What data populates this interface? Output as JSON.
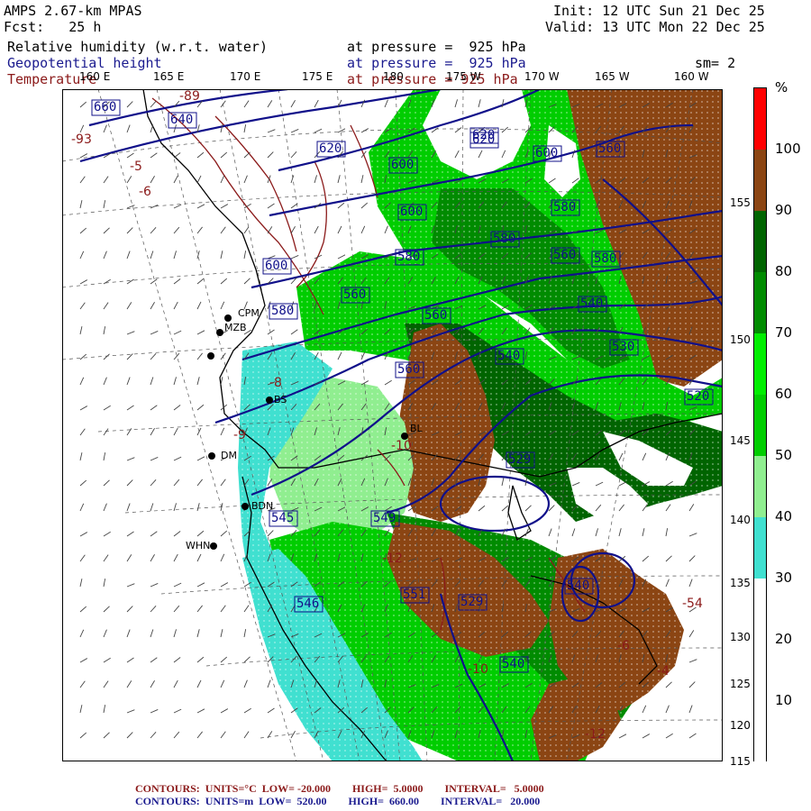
{
  "header": {
    "model": "AMPS 2.67-km MPAS",
    "init": "Init: 12 UTC Sun 21 Dec 25",
    "fcst": "Fcst:   25 h",
    "valid": "Valid: 13 UTC Mon 22 Dec 25",
    "var1": "Relative humidity (w.r.t. water)",
    "var1_level": "at pressure =  925 hPa",
    "var2": "Geopotential height",
    "var2_level": "at pressure =  925 hPa",
    "smoothing": "sm= 2",
    "var3": "Temperature",
    "var3_level": "at pressure = 925 hPa"
  },
  "colors": {
    "height_contour": "#10108a",
    "temp_contour": "#8b1a1a",
    "coast": "#000000"
  },
  "colorbar": {
    "unit": "%",
    "labels": [
      "100",
      "90",
      "80",
      "70",
      "60",
      "50",
      "40",
      "30",
      "20",
      "10"
    ],
    "segments": [
      {
        "from": 100,
        "to": 110,
        "color": "#ff0000"
      },
      {
        "from": 90,
        "to": 100,
        "color": "#8b4513"
      },
      {
        "from": 80,
        "to": 90,
        "color": "#006400"
      },
      {
        "from": 70,
        "to": 80,
        "color": "#008b00"
      },
      {
        "from": 60,
        "to": 70,
        "color": "#00ee00"
      },
      {
        "from": 50,
        "to": 60,
        "color": "#00cd00"
      },
      {
        "from": 40,
        "to": 50,
        "color": "#90ee90"
      },
      {
        "from": 30,
        "to": 40,
        "color": "#40e0d0"
      },
      {
        "from": 0,
        "to": 30,
        "color": "#ffffff"
      }
    ]
  },
  "longitude_labels": [
    "160 E",
    "165 E",
    "170 E",
    "175 E",
    "180",
    "175 W",
    "170 W",
    "165 W",
    "160 W"
  ],
  "latitude_labels": [
    "155",
    "150",
    "145",
    "140",
    "135",
    "130",
    "125",
    "120",
    "115"
  ],
  "stations": [
    "CPM",
    "MZB",
    "BS",
    "DM",
    "BDN",
    "BL",
    "WHN"
  ],
  "height_labels": [
    "660",
    "640",
    "620",
    "620",
    "600",
    "600",
    "580",
    "560",
    "600",
    "580",
    "560",
    "540",
    "560",
    "540",
    "530",
    "520",
    "529",
    "551",
    "546",
    "529",
    "540",
    "545",
    "539",
    "540",
    "549",
    "580",
    "580",
    "560",
    "560",
    "620",
    "600",
    "580"
  ],
  "temp_labels": [
    "-89",
    "-93",
    "-5",
    "-6",
    "-8",
    "-9",
    "-10",
    "-12",
    "-54",
    "-6",
    "-4",
    "-10",
    "-12"
  ],
  "footer": {
    "temp": "CONTOURS:  UNITS=°C  LOW= -20.000        HIGH=  5.0000        INTERVAL=   5.0000",
    "height": "CONTOURS:  UNITS=m  LOW=  520.00        HIGH=  660.00        INTERVAL=   20.000"
  }
}
